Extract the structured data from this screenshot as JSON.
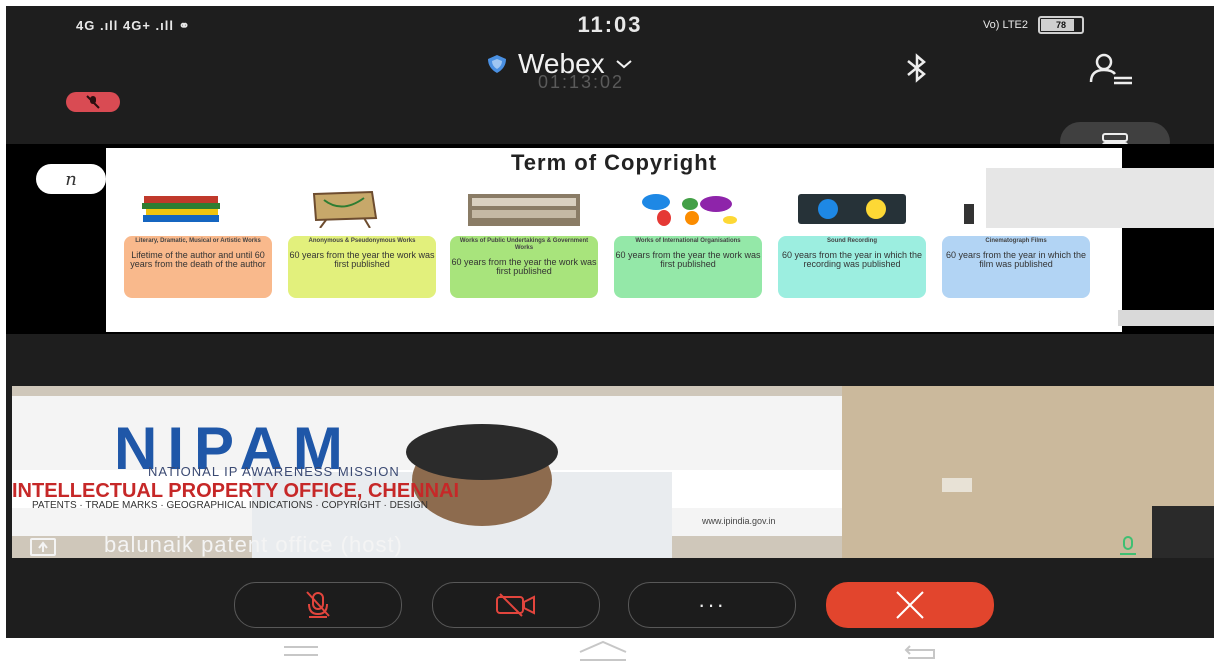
{
  "status": {
    "left_indicators": "4G .ıll 4G+ .ıll ⚭",
    "time": "11:03",
    "right_indicators": "Vo) LTE2",
    "battery": "78",
    "battery_level": 0.78
  },
  "meeting": {
    "app_name": "Webex",
    "timer": "01:13:02"
  },
  "slide": {
    "title": "Term of Copyright",
    "annotation_glyph": "n",
    "cards": [
      {
        "title": "Literary, Dramatic, Musical or Artistic Works",
        "body": "Lifetime of the author and until 60 years from the death of the author",
        "color": "#f9b98c"
      },
      {
        "title": "Anonymous & Pseudonymous Works",
        "body": "60 years from the year the work was first published",
        "color": "#e2f07c"
      },
      {
        "title": "Works of Public Undertakings & Government Works",
        "body": "60 years from the year the work was first published",
        "color": "#a8e47c"
      },
      {
        "title": "Works of International Organisations",
        "body": "60 years from the year the work was first published",
        "color": "#94e8a8"
      },
      {
        "title": "Sound Recording",
        "body": "60 years from the year in which the recording was published",
        "color": "#9ceee0"
      },
      {
        "title": "Cinematograph Films",
        "body": "60 years from the year in which the film was published",
        "color": "#b2d4f4"
      }
    ]
  },
  "video": {
    "banner_logo": "NIPAM",
    "banner_subtitle": "NATIONAL IP AWARENESS MISSION",
    "banner_office": "INTELLECTUAL PROPERTY OFFICE, CHENNAI",
    "banner_line": "PATENTS · TRADE MARKS · GEOGRAPHICAL INDICATIONS · COPYRIGHT · DESIGN",
    "banner_web": "www.ipindia.gov.in",
    "participant_name": "balunaik patent office (host)"
  },
  "controls": {
    "mute_label": "Unmute",
    "video_label": "Start video",
    "more_label": "···",
    "end_label": "Leave"
  },
  "colors": {
    "background": "#1e1e1e",
    "end_button": "#e2452d",
    "mute_indicator": "#d94b53",
    "shield": "#4a90e2",
    "mic_active": "#3fbf72"
  },
  "icons": [
    "shield-icon",
    "chevron-down-icon",
    "bluetooth-icon",
    "participants-icon",
    "muted-mic-icon",
    "layout-icon",
    "annotate-icon",
    "share-icon",
    "mic-icon",
    "video-off-icon",
    "more-icon",
    "close-icon",
    "recent-apps-icon",
    "home-icon",
    "back-icon"
  ]
}
